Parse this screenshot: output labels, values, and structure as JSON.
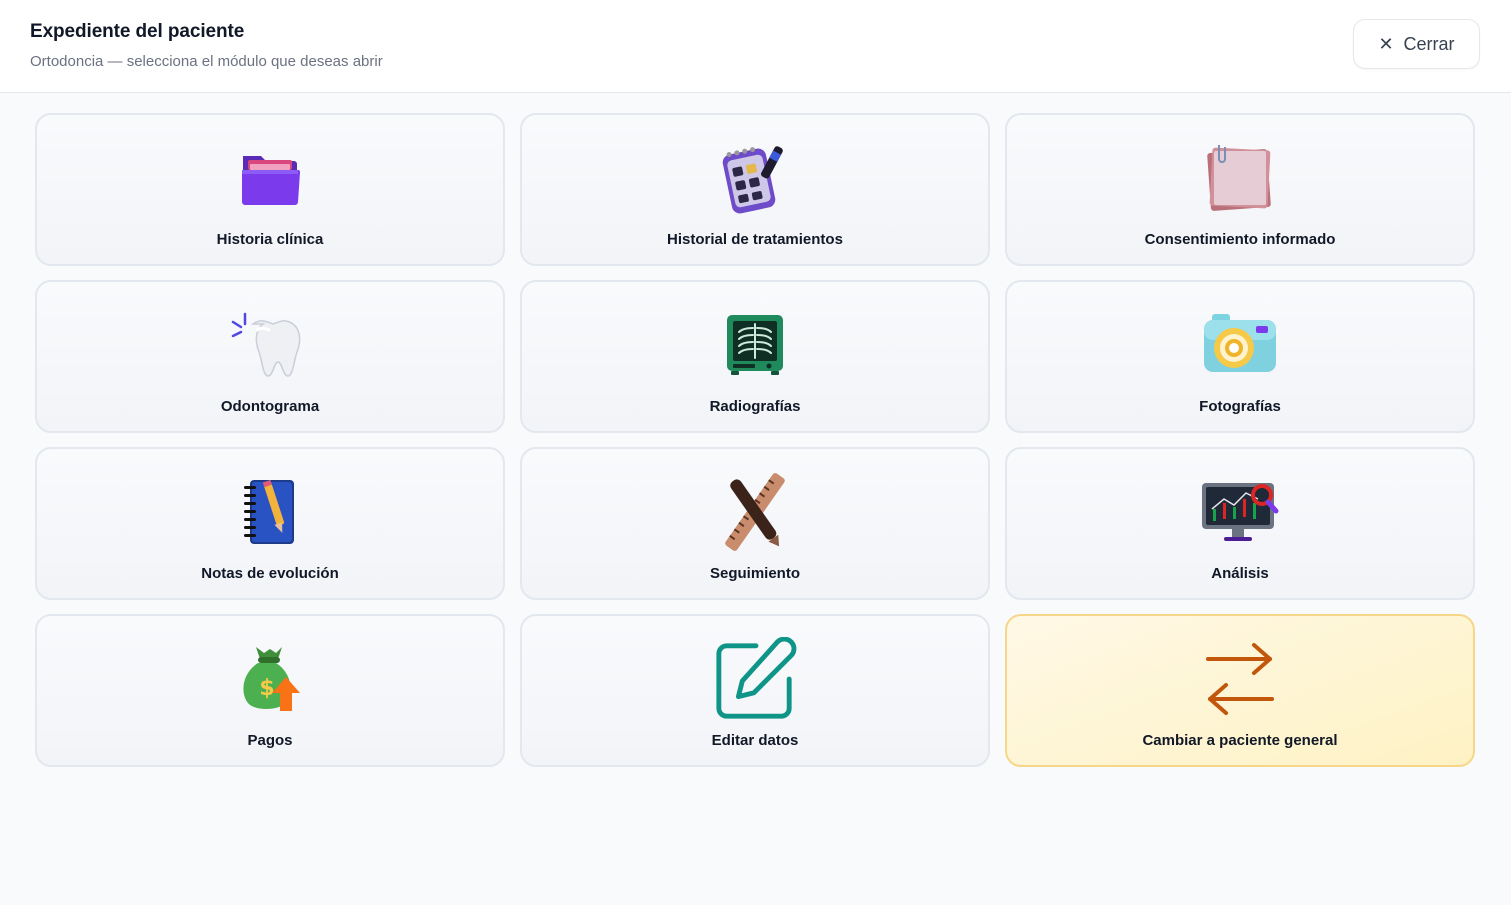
{
  "header": {
    "title": "Expediente del paciente",
    "subtitle": "Ortodoncia — selecciona el módulo que deseas abrir",
    "close_label": "Cerrar"
  },
  "modules": [
    {
      "label": "Historia clínica",
      "icon": "folder-icon"
    },
    {
      "label": "Historial de tratamientos",
      "icon": "checklist-notepad-icon"
    },
    {
      "label": "Consentimiento informado",
      "icon": "sticky-notes-icon"
    },
    {
      "label": "Odontograma",
      "icon": "tooth-icon"
    },
    {
      "label": "Radiografías",
      "icon": "xray-icon"
    },
    {
      "label": "Fotografías",
      "icon": "camera-icon"
    },
    {
      "label": "Notas de evolución",
      "icon": "notebook-pencil-icon"
    },
    {
      "label": "Seguimiento",
      "icon": "ruler-pen-icon"
    },
    {
      "label": "Análisis",
      "icon": "monitor-chart-icon"
    },
    {
      "label": "Pagos",
      "icon": "money-bag-icon"
    },
    {
      "label": "Editar datos",
      "icon": "edit-icon"
    },
    {
      "label": "Cambiar a paciente general",
      "icon": "swap-arrows-icon"
    }
  ],
  "colors": {
    "highlight_bg": "#fef2c4",
    "highlight_border": "#f6d78a",
    "edit_teal": "#0f9488",
    "swap_orange": "#c2570c"
  }
}
